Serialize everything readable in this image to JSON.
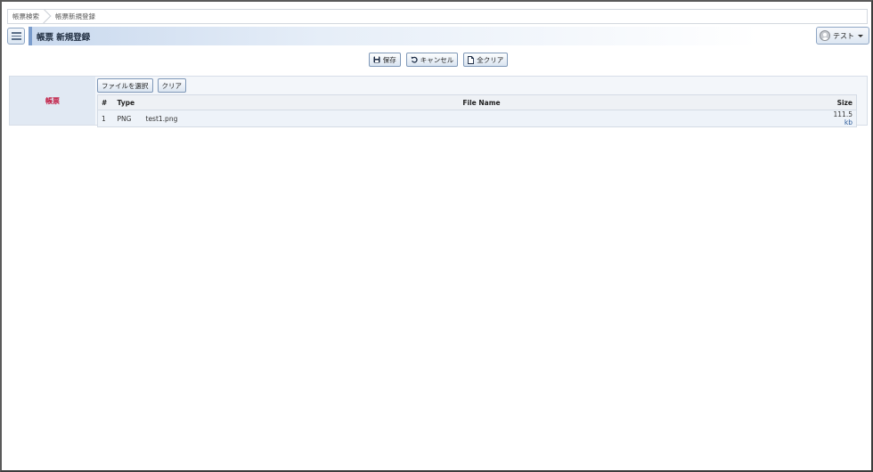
{
  "breadcrumb": {
    "items": [
      "帳票検索",
      "帳票新規登録"
    ]
  },
  "header": {
    "title": "帳票 新規登録",
    "user_name": "テスト"
  },
  "toolbar": {
    "save_label": "保存",
    "cancel_label": "キャンセル",
    "clear_all_label": "全クリア"
  },
  "form": {
    "field_label": "帳票",
    "select_file_label": "ファイルを選択",
    "clear_label": "クリア",
    "table": {
      "headers": {
        "num": "#",
        "type": "Type",
        "file_name": "File Name",
        "size": "Size"
      },
      "rows": [
        {
          "num": "1",
          "type": "PNG",
          "file_name": "test1.png",
          "size": "111.5",
          "unit": "kb"
        }
      ]
    }
  },
  "colors": {
    "accent": "#7a9ccc",
    "label_text": "#c0143c",
    "label_bg": "#e1e9f3"
  }
}
